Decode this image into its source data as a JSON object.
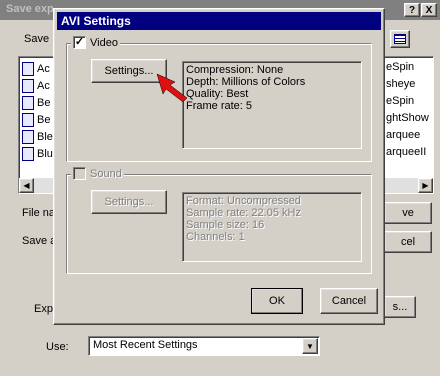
{
  "background_dialog": {
    "title": "Save exp",
    "help_glyph": "?",
    "close_glyph": "X",
    "save_in_label": "Save",
    "list_items_left": [
      "Ac",
      "Ac",
      "Be",
      "Be",
      "Ble",
      "Blu"
    ],
    "list_items_right": [
      "eSpin",
      "sheye",
      "eSpin",
      "ghtShow",
      "arquee",
      "arqueeII"
    ],
    "file_name_label": "File na",
    "save_as_label": "Save a",
    "save_button_label": "ve",
    "cancel_button_label": "cel",
    "export_label": "Exp",
    "options_button_label": "s...",
    "use_label": "Use:",
    "use_value": "Most Recent Settings"
  },
  "avi_dialog": {
    "title": "AVI Settings",
    "video": {
      "checkbox_label": "Video",
      "checked": true,
      "settings_button": "Settings...",
      "info": [
        "Compression: None",
        "Depth: Millions of Colors",
        "Quality: Best",
        "Frame rate: 5"
      ]
    },
    "sound": {
      "checkbox_label": "Sound",
      "checked": false,
      "settings_button": "Settings...",
      "info": [
        "Format: Uncompressed",
        "Sample rate: 22.05 kHz",
        "Sample size: 16",
        "Channels: 1"
      ]
    },
    "ok_label": "OK",
    "cancel_label": "Cancel"
  },
  "annotation": {
    "arrow_color": "#e01010"
  }
}
